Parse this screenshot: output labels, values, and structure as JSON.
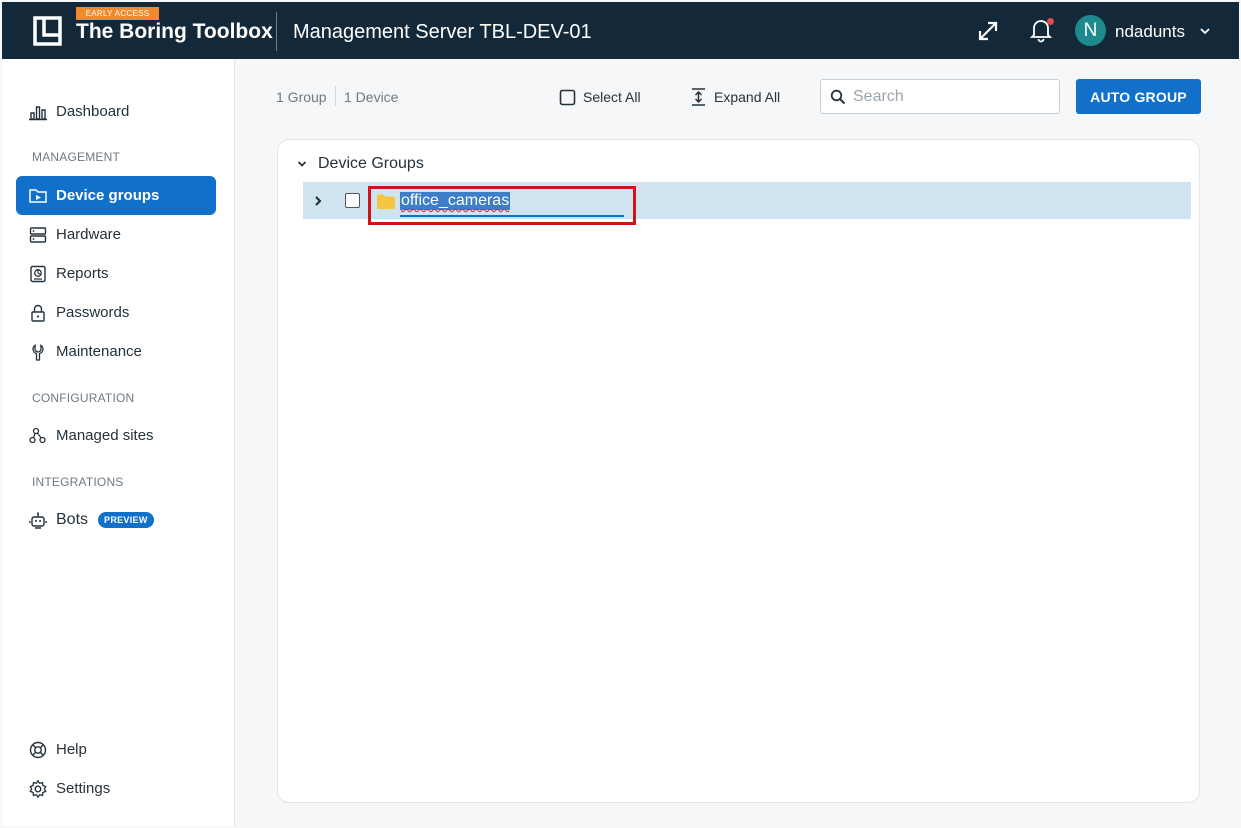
{
  "header": {
    "badge": "EARLY ACCESS",
    "brand": "The Boring Toolbox",
    "server_title": "Management Server TBL-DEV-01",
    "user": {
      "initial": "N",
      "name": "ndadunts"
    }
  },
  "sidebar": {
    "dashboard": "Dashboard",
    "management_label": "MANAGEMENT",
    "management": [
      "Device groups",
      "Hardware",
      "Reports",
      "Passwords",
      "Maintenance"
    ],
    "configuration_label": "CONFIGURATION",
    "configuration": [
      "Managed sites"
    ],
    "integrations_label": "INTEGRATIONS",
    "bots": "Bots",
    "bots_badge": "PREVIEW",
    "help": "Help",
    "settings": "Settings",
    "active": "Device groups"
  },
  "toolbar": {
    "group_count": "1 Group",
    "device_count": "1 Device",
    "select_all": "Select All",
    "expand_all": "Expand All",
    "search_placeholder": "Search",
    "auto_group": "AUTO GROUP"
  },
  "tree": {
    "root_label": "Device Groups",
    "rows": [
      {
        "name": "office_cameras",
        "editing": true
      }
    ]
  },
  "colors": {
    "topbar": "#13293a",
    "accent": "#1170c9",
    "badge_orange": "#f08a2c",
    "row_selected": "#cfe3f1",
    "highlight_red": "#d0131b"
  }
}
